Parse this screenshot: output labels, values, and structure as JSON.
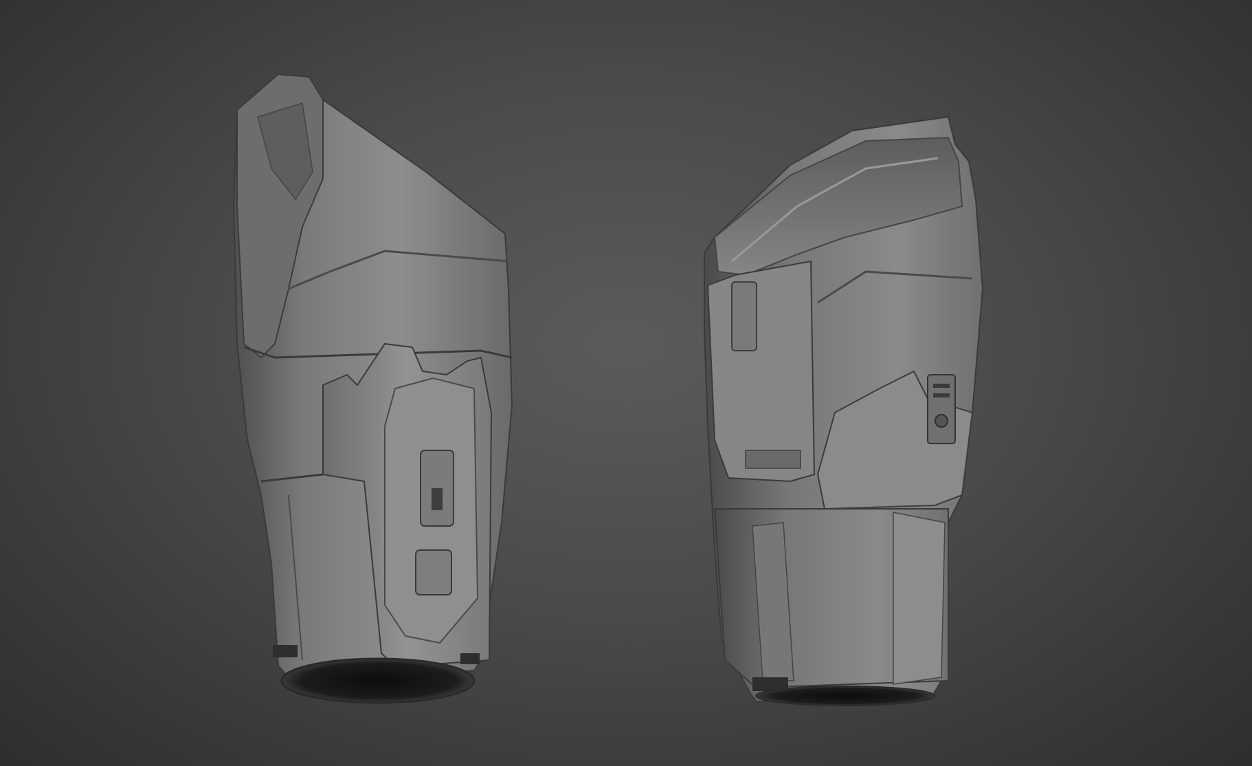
{
  "scene": {
    "objects": [
      {
        "name": "vambrace-side-view"
      },
      {
        "name": "vambrace-three-quarter-view"
      }
    ]
  }
}
